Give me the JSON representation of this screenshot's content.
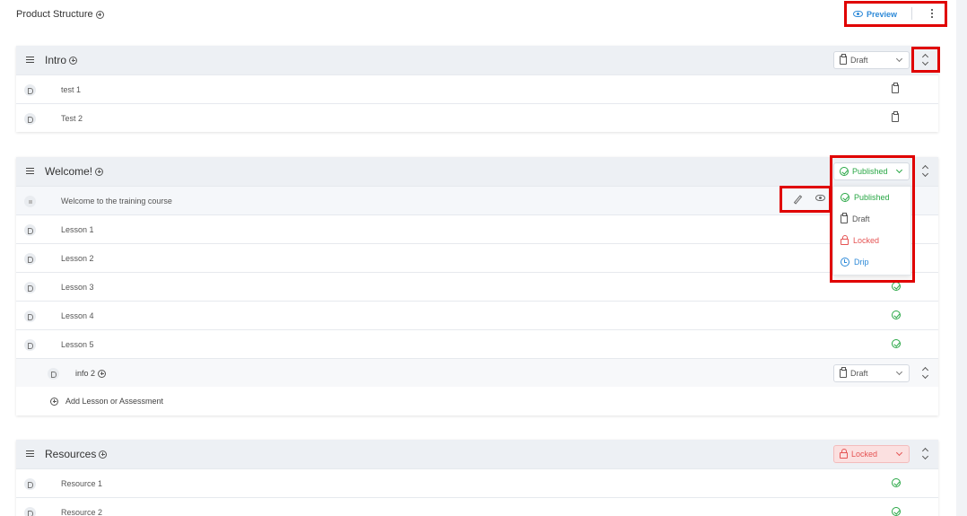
{
  "header": {
    "title": "Product Structure",
    "preview_label": "Preview"
  },
  "sections": [
    {
      "title": "Intro",
      "status": "Draft",
      "rows": [
        {
          "label": "test 1",
          "status_icon": "clipboard-icon"
        },
        {
          "label": "Test 2",
          "status_icon": "clipboard-icon"
        }
      ]
    },
    {
      "title": "Welcome!",
      "status": "Published",
      "rows": [
        {
          "label": "Welcome to the training course"
        },
        {
          "label": "Lesson 1"
        },
        {
          "label": "Lesson 2"
        },
        {
          "label": "Lesson 3",
          "status_icon": "check-circle-icon"
        },
        {
          "label": "Lesson 4",
          "status_icon": "check-circle-icon"
        },
        {
          "label": "Lesson 5",
          "status_icon": "check-circle-icon"
        }
      ],
      "subgroup": {
        "title": "info 2",
        "status": "Draft"
      },
      "add_label": "Add Lesson or Assessment"
    },
    {
      "title": "Resources",
      "status": "Locked",
      "rows": [
        {
          "label": "Resource 1",
          "status_icon": "check-circle-icon"
        },
        {
          "label": "Resource 2",
          "status_icon": "check-circle-icon"
        }
      ]
    }
  ],
  "status_dropdown": {
    "options": [
      "Published",
      "Draft",
      "Locked",
      "Drip"
    ]
  },
  "colors": {
    "published": "#28a745",
    "locked": "#e55353",
    "drip": "#2e8ad8",
    "highlight": "#e00000"
  }
}
